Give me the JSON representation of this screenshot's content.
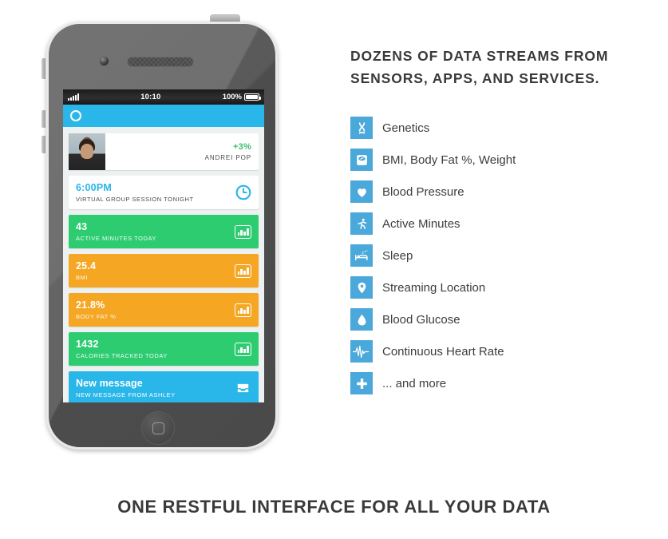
{
  "headline": {
    "line1": "Dozens of data streams from",
    "line2": "sensors, apps, and services."
  },
  "footer": {
    "text": "One RESTful interface for all your data"
  },
  "colors": {
    "accent_blue": "#29b6e8",
    "icon_blue": "#4aa8da",
    "green": "#2ecc71",
    "orange": "#f5a623",
    "text_dark": "#3a3a3a"
  },
  "phone": {
    "status_bar": {
      "time": "10:10",
      "battery_percent": "100%",
      "signal_bars": 5
    },
    "nav": {
      "logo": "circle-logo"
    },
    "profile_card": {
      "percent_change": "+3%",
      "user_name": "ANDREI POP",
      "avatar": "user-photo"
    },
    "event_card": {
      "time": "6:00PM",
      "description": "VIRTUAL GROUP SESSION TONIGHT",
      "icon": "clock-icon"
    },
    "stat_cards": [
      {
        "value": "43",
        "label": "ACTIVE MINUTES TODAY",
        "color": "#2ecc71",
        "icon": "bar-chart-icon"
      },
      {
        "value": "25.4",
        "label": "BMI",
        "color": "#f5a623",
        "icon": "bar-chart-icon"
      },
      {
        "value": "21.8%",
        "label": "BODY FAT %",
        "color": "#f5a623",
        "icon": "bar-chart-icon"
      },
      {
        "value": "1432",
        "label": "CALORIES TRACKED TODAY",
        "color": "#2ecc71",
        "icon": "bar-chart-icon"
      }
    ],
    "message_card": {
      "title": "New message",
      "subtitle": "NEW MESSAGE FROM ASHLEY",
      "icon": "inbox-icon"
    }
  },
  "features": [
    {
      "label": "Genetics",
      "icon": "dna-icon"
    },
    {
      "label": "BMI, Body Fat %, Weight",
      "icon": "scale-icon"
    },
    {
      "label": "Blood Pressure",
      "icon": "heart-icon"
    },
    {
      "label": "Active Minutes",
      "icon": "running-icon"
    },
    {
      "label": "Sleep",
      "icon": "bed-icon"
    },
    {
      "label": "Streaming Location",
      "icon": "map-pin-icon"
    },
    {
      "label": "Blood Glucose",
      "icon": "droplet-icon"
    },
    {
      "label": "Continuous Heart Rate",
      "icon": "heartbeat-icon"
    },
    {
      "label": "... and more",
      "icon": "plus-icon"
    }
  ]
}
